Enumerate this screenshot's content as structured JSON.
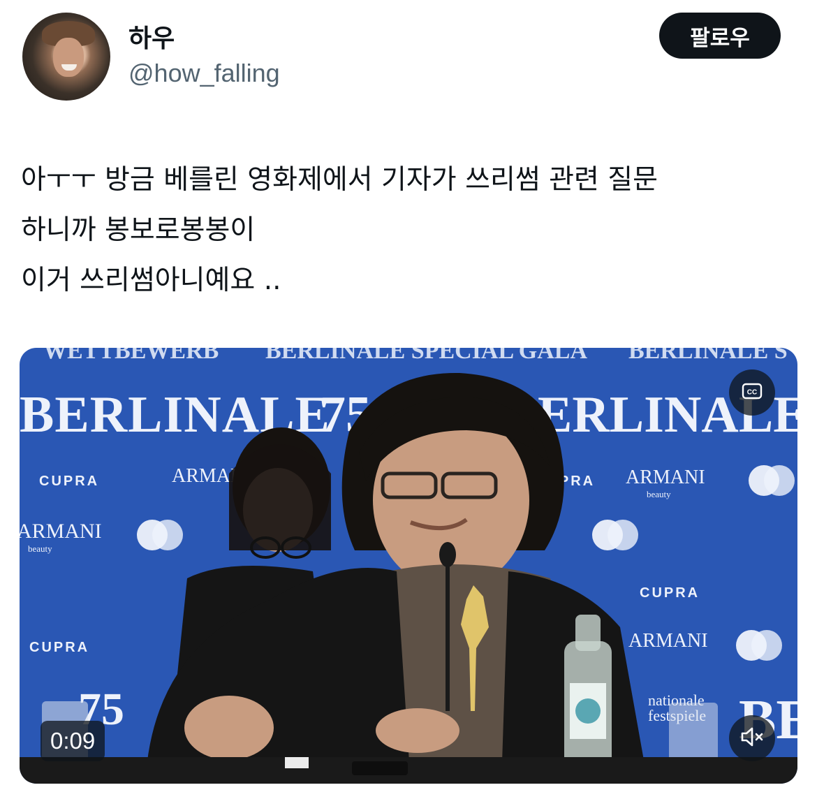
{
  "tweet": {
    "author": {
      "display_name": "하우",
      "handle": "@how_falling"
    },
    "follow_label": "팔로우",
    "text_lines": [
      "아ㅜㅜ 방금 베를린 영화제에서 기자가 쓰리썸 관련 질문",
      "하니까 봉보로봉봉이",
      "이거 쓰리썸아니예요 .."
    ]
  },
  "media": {
    "duration": "0:09",
    "backdrop_text": {
      "top_banner": [
        "WETTBEWERB",
        "BERLINALE SPECIAL GALA",
        "BERLINALE S"
      ],
      "berlinale_left": "BERLINALE",
      "berlinale_right": "ERLINALE",
      "number_75": "75",
      "number_75_bottom": "75",
      "cupra": "CUPRA",
      "armani": "ARMANI",
      "beauty": "beauty",
      "internationale": "nationale",
      "filmfestspiele": "festspiele",
      "bottom_right": "BEI"
    },
    "icons": [
      "closed-captions-icon",
      "mute-icon"
    ],
    "colors": {
      "backdrop_blue": "#2a57b4",
      "overlay": "#0f1419"
    }
  }
}
